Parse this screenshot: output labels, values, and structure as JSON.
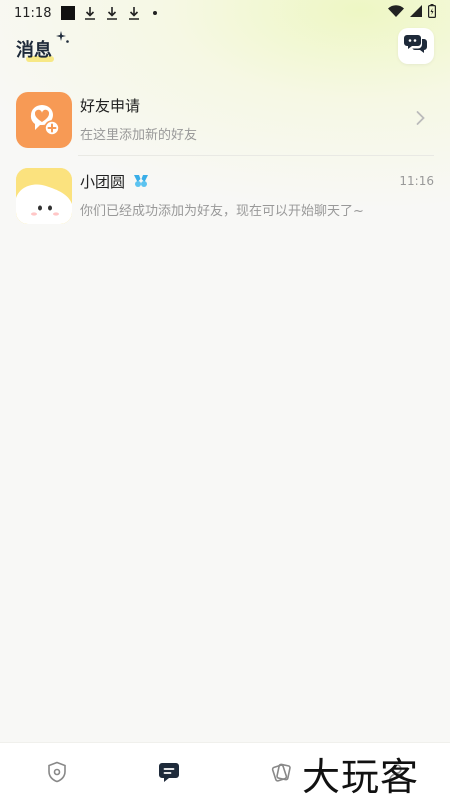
{
  "status_bar": {
    "time": "11:18"
  },
  "header": {
    "title": "消息"
  },
  "list": [
    {
      "title": "好友申请",
      "subtitle": "在这里添加新的好友"
    },
    {
      "title": "小团圆",
      "subtitle": "你们已经成功添加为好友，现在可以开始聊天了~",
      "time": "11:16"
    }
  ],
  "bottom_nav": {
    "active_index": 1
  },
  "watermark": "大玩客",
  "colors": {
    "accent_orange": "#f79a55",
    "avatar_yellow": "#fbe27e",
    "title_color": "#1e2a3a",
    "vip_blue": "#3aaee8"
  }
}
